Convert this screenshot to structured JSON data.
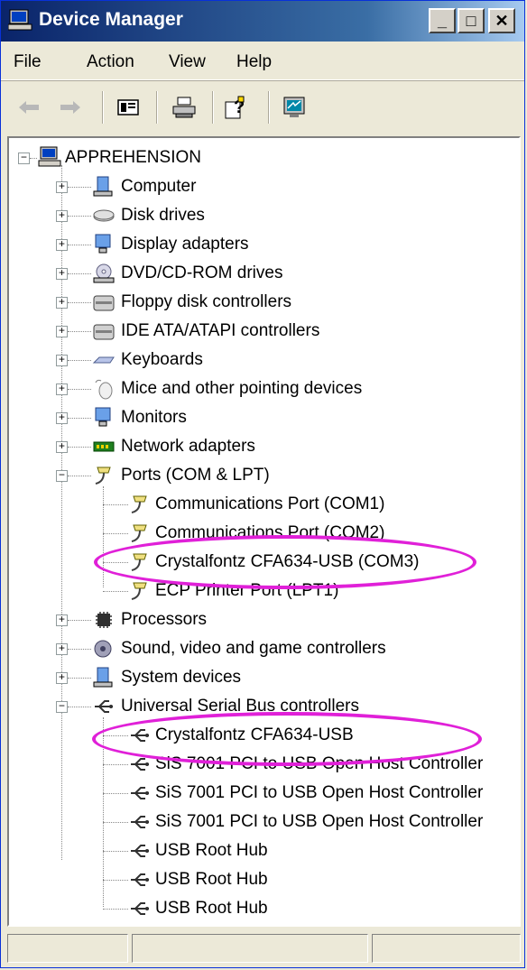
{
  "window": {
    "title": "Device Manager"
  },
  "caption_buttons": {
    "minimize": "_",
    "maximize": "□",
    "close": "✕"
  },
  "menu": {
    "file": "File",
    "action": "Action",
    "view": "View",
    "help": "Help"
  },
  "toolbar": {
    "buttons": [
      "back-arrow-icon",
      "forward-arrow-icon",
      "properties-icon",
      "print-icon",
      "help-icon",
      "computer-monitor-icon"
    ]
  },
  "tree": {
    "root": "APPREHENSION",
    "categories": {
      "computer": "Computer",
      "disk": "Disk drives",
      "display": "Display adapters",
      "dvd": "DVD/CD-ROM drives",
      "floppy": "Floppy disk controllers",
      "ide": "IDE ATA/ATAPI controllers",
      "keyboards": "Keyboards",
      "mice": "Mice and other pointing devices",
      "monitors": "Monitors",
      "network": "Network adapters",
      "ports": "Ports (COM & LPT)",
      "processors": "Processors",
      "sound": "Sound, video and game controllers",
      "system": "System devices",
      "usb": "Universal Serial Bus controllers"
    },
    "ports_children": [
      "Communications Port (COM1)",
      "Communications Port (COM2)",
      "Crystalfontz CFA634-USB (COM3)",
      "ECP Printer Port (LPT1)"
    ],
    "usb_children": [
      "Crystalfontz CFA634-USB",
      "SiS 7001 PCI to USB Open Host Controller",
      "SiS 7001 PCI to USB Open Host Controller",
      "SiS 7001 PCI to USB Open Host Controller",
      "USB Root Hub",
      "USB Root Hub",
      "USB Root Hub"
    ]
  },
  "colors": {
    "highlight": "#e020d8",
    "titlebar": "#0a246a"
  }
}
